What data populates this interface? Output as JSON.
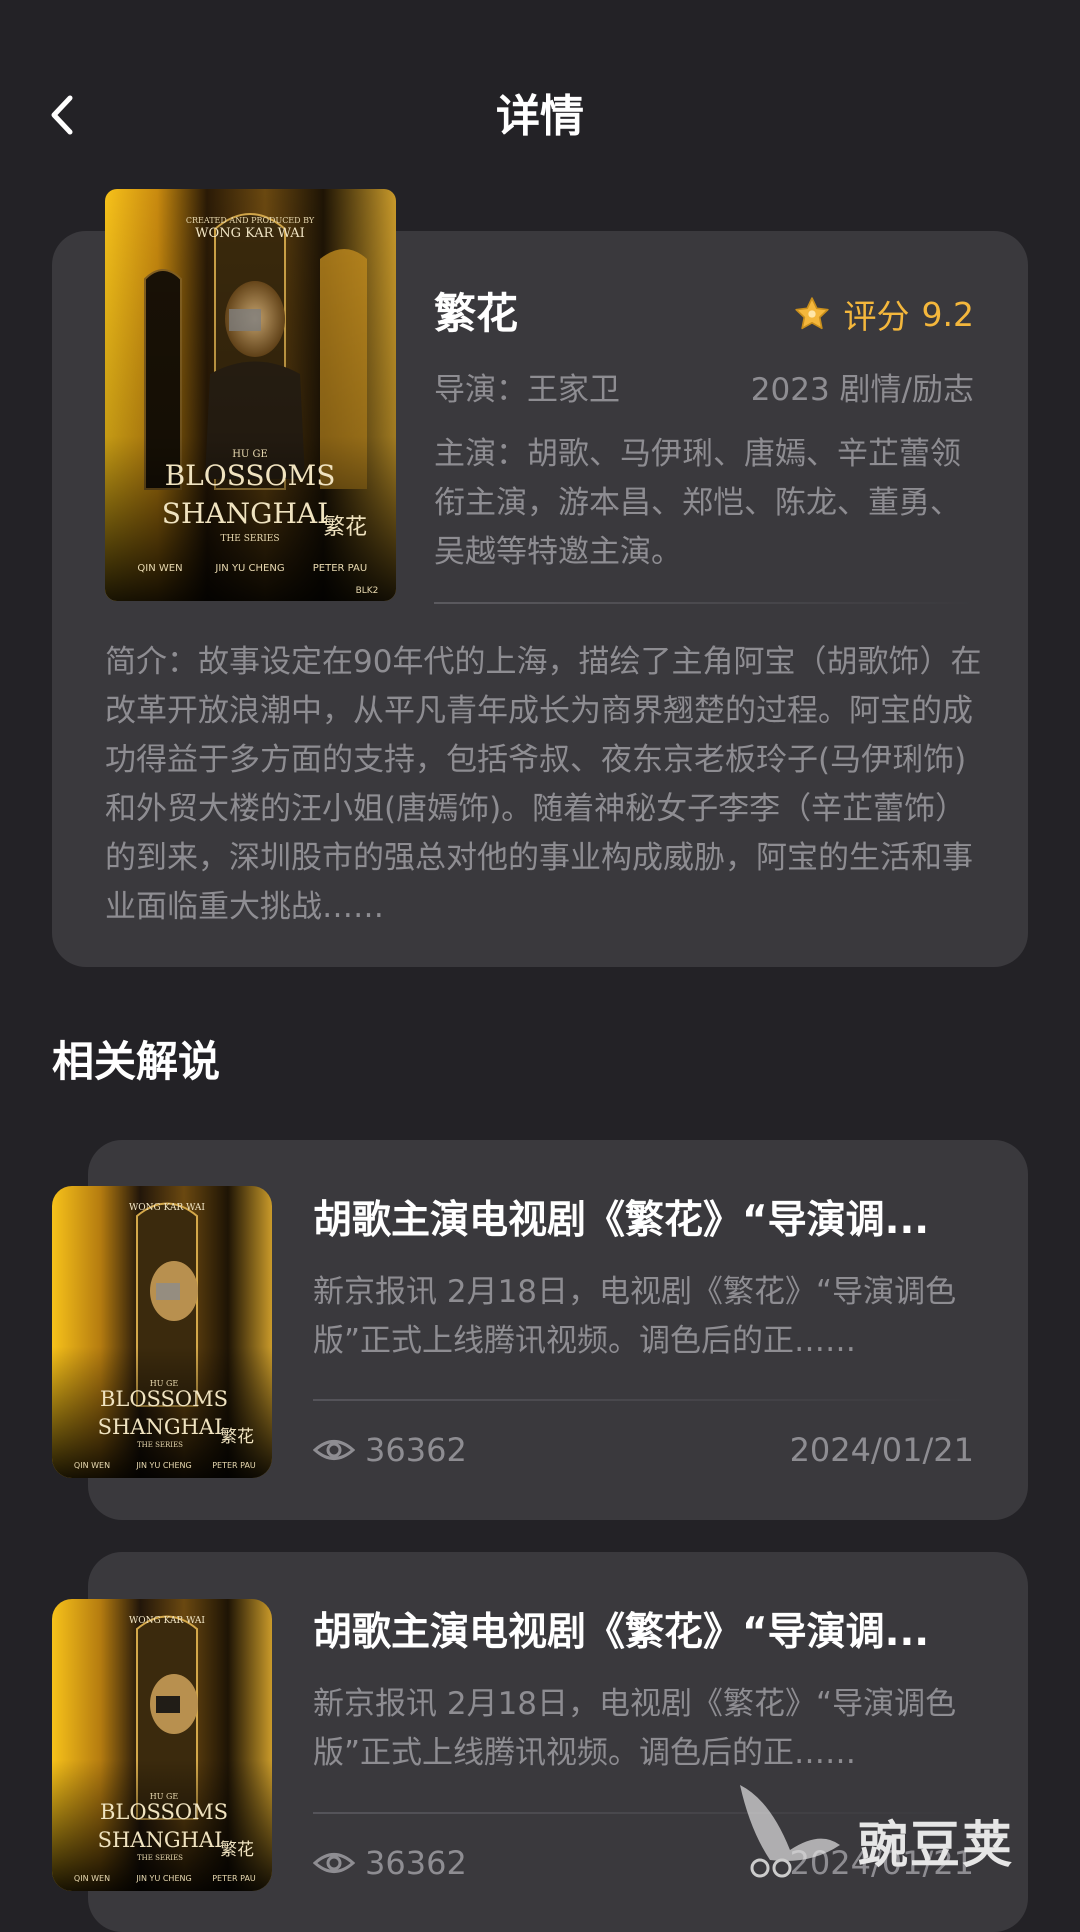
{
  "header": {
    "title": "详情"
  },
  "show": {
    "title": "繁花",
    "rating_label": "评分",
    "rating_value": "9.2",
    "director": "导演：王家卫",
    "meta": "2023 剧情/励志",
    "cast": "主演：胡歌、马伊琍、唐嫣、辛芷蕾领衔主演，游本昌、郑恺、陈龙、董勇、吴越等特邀主演。",
    "synopsis": "简介：故事设定在90年代的上海，描绘了主角阿宝（胡歌饰）在改革开放浪潮中，从平凡青年成长为商界翘楚的过程。阿宝的成功得益于多方面的支持，包括爷叔、夜东京老板玲子(马伊琍饰)和外贸大楼的汪小姐(唐嫣饰)。随着神秘女子李李（辛芷蕾饰）的到来，深圳股市的强总对他的事业构成威胁，阿宝的生活和事业面临重大挑战……",
    "poster": {
      "credit_top": "CREATED AND PRODUCED BY",
      "creator": "WONG KAR WAI",
      "starring": "HU GE",
      "title_line1": "BLOSSOMS",
      "title_line2": "SHANGHAI",
      "subtitle": "THE SERIES",
      "cn_title": "繁花",
      "credit1": "QIN WEN",
      "credit2": "JIN YU CHENG",
      "credit3": "PETER PAU",
      "badge": "BLK2"
    }
  },
  "related": {
    "heading": "相关解说",
    "items": [
      {
        "title": "胡歌主演电视剧《繁花》“导演调...",
        "excerpt": "新京报讯 2月18日，电视剧《繁花》“导演调色版”正式上线腾讯视频。调色后的正……",
        "views": "36362",
        "date": "2024/01/21"
      },
      {
        "title": "胡歌主演电视剧《繁花》“导演调...",
        "excerpt": "新京报讯 2月18日，电视剧《繁花》“导演调色版”正式上线腾讯视频。调色后的正……",
        "views": "36362",
        "date": "2024/01/21"
      }
    ]
  },
  "watermark": {
    "text": "豌豆荚"
  },
  "colors": {
    "background": "#232226",
    "card": "#3a393d",
    "accent": "#f4b73c",
    "muted_text": "#8e8d92"
  },
  "icons": {
    "back": "chevron-left-icon",
    "star": "star-icon",
    "views": "eye-icon"
  }
}
